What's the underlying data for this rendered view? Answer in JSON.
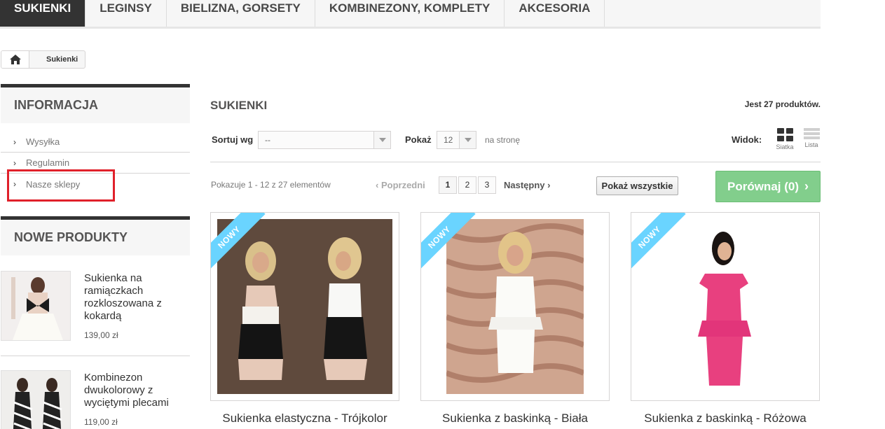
{
  "topmenu": {
    "items": [
      {
        "label": "SUKIENKI",
        "active": true
      },
      {
        "label": "LEGINSY",
        "active": false
      },
      {
        "label": "BIELIZNA, GORSETY",
        "active": false
      },
      {
        "label": "KOMBINEZONY, KOMPLETY",
        "active": false
      },
      {
        "label": "AKCESORIA",
        "active": false
      }
    ]
  },
  "breadcrumb": {
    "home_icon": "home-icon",
    "current": "Sukienki"
  },
  "sidebar": {
    "info_title": "INFORMACJA",
    "info_items": [
      "Wysyłka",
      "Regulamin",
      "Nasze sklepy"
    ],
    "highlighted_item": "Nasze sklepy",
    "highlight_color": "#e0202a",
    "new_title": "NOWE PRODUKTY",
    "new_products": [
      {
        "name": "Sukienka na ramiączkach rozkloszowana z kokardą",
        "price": "139,00 zł"
      },
      {
        "name": "Kombinezon dwukolorowy z wyciętymi plecami",
        "price": "119,00 zł"
      }
    ]
  },
  "main": {
    "heading": "SUKIENKI",
    "count_text": "Jest 27 produktów.",
    "sort_label": "Sortuj wg",
    "sort_value": "--",
    "show_label": "Pokaż",
    "show_value": "12",
    "per_page_text": "na stronę",
    "view_label": "Widok:",
    "view_grid": "Siatka",
    "view_list": "Lista",
    "results_text": "Pokazuje 1 - 12 z 27 elementów",
    "prev_label": "Poprzedni",
    "next_label": "Następny",
    "pages": [
      "1",
      "2",
      "3"
    ],
    "current_page": "1",
    "show_all": "Pokaż wszystkie",
    "compare_label": "Porównaj (0)",
    "compare_color": "#75c980",
    "ribbon_label": "NOWY",
    "ribbon_color": "#6ad4ff",
    "products": [
      {
        "name": "Sukienka elastyczna - Trójkolor"
      },
      {
        "name": "Sukienka z baskinką - Biała"
      },
      {
        "name": "Sukienka z baskinką - Różowa"
      }
    ]
  }
}
